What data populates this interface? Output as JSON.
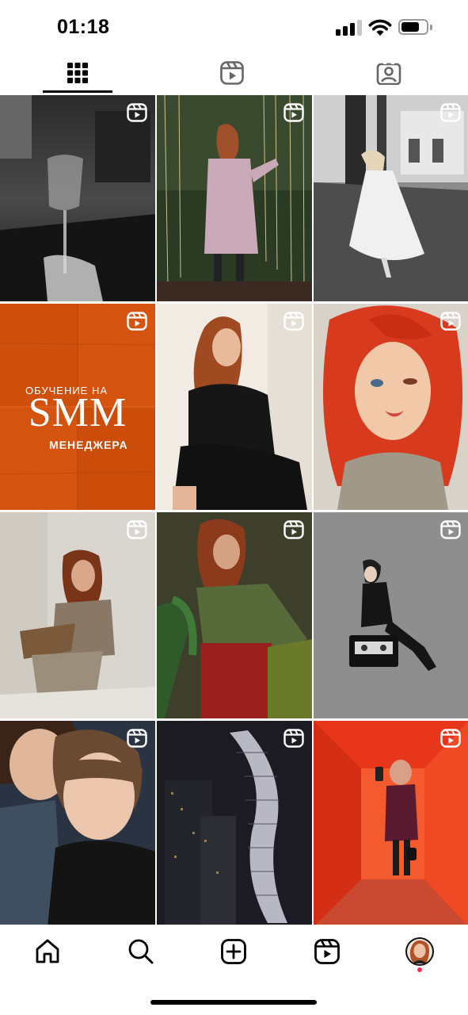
{
  "status_bar": {
    "time": "01:18"
  },
  "profile_tabs": [
    {
      "name": "posts-grid",
      "icon": "grid-icon",
      "active": true
    },
    {
      "name": "reels",
      "icon": "reels-icon",
      "active": false
    },
    {
      "name": "tagged",
      "icon": "tagged-person-icon",
      "active": false
    }
  ],
  "grid": {
    "promo_tile": {
      "line1": "ОБУЧЕНИЕ НА",
      "title": "SMM",
      "line2": "МЕНЕДЖЕРА"
    },
    "badge_icon": "reels-icon",
    "items_count_visible": 12
  },
  "bottom_nav": [
    {
      "name": "home",
      "icon": "home-icon"
    },
    {
      "name": "search",
      "icon": "search-icon"
    },
    {
      "name": "create",
      "icon": "plus-square-icon"
    },
    {
      "name": "reels",
      "icon": "reels-icon"
    },
    {
      "name": "profile",
      "icon": "avatar"
    }
  ],
  "colors": {
    "accent_dot": "#ff2d55",
    "promo_orange": "#d4540f"
  }
}
